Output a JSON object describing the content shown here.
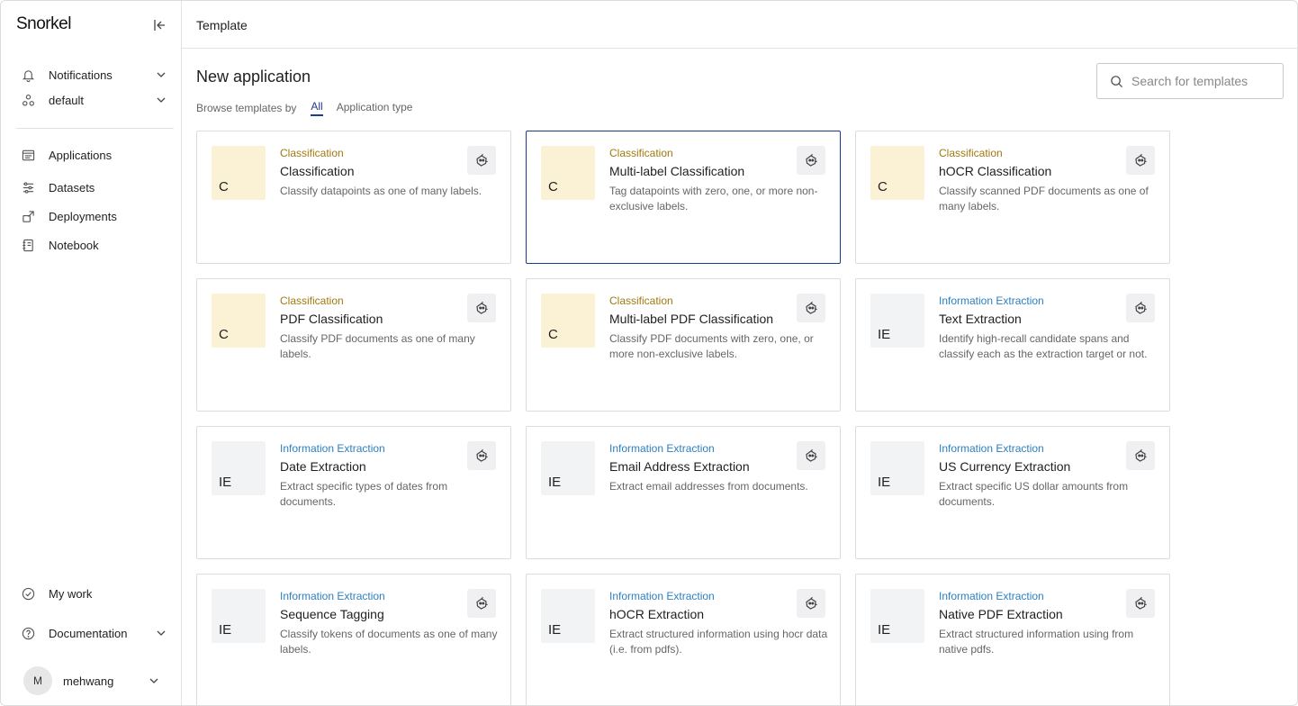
{
  "app": {
    "logo": "Snorkel"
  },
  "sidebar": {
    "notifications": "Notifications",
    "workspace": "default",
    "nav": [
      {
        "label": "Applications",
        "icon": "applications-icon"
      },
      {
        "label": "Datasets",
        "icon": "datasets-icon"
      },
      {
        "label": "Deployments",
        "icon": "deployments-icon"
      },
      {
        "label": "Notebook",
        "icon": "notebook-icon"
      }
    ],
    "my_work": "My work",
    "documentation": "Documentation",
    "user": {
      "initial": "M",
      "name": "mehwang"
    }
  },
  "topbar": {
    "title": "Template"
  },
  "main": {
    "title": "New application",
    "browse_label": "Browse templates by",
    "tabs": [
      "All",
      "Application type"
    ],
    "active_tab": "All",
    "search_placeholder": "Search for templates"
  },
  "colors": {
    "accent": "#1e3a8a",
    "classification": "#a07a10",
    "extraction": "#2d7fc0",
    "classification_bg": "#fbf2d5",
    "extraction_bg": "#f2f3f5"
  },
  "templates": [
    {
      "badge": "C",
      "category": "Classification",
      "name": "Classification",
      "description": "Classify datapoints as one of many labels.",
      "selected": false
    },
    {
      "badge": "C",
      "category": "Classification",
      "name": "Multi-label Classification",
      "description": "Tag datapoints with zero, one, or more non-exclusive labels.",
      "selected": true
    },
    {
      "badge": "C",
      "category": "Classification",
      "name": "hOCR Classification",
      "description": "Classify scanned PDF documents as one of many labels.",
      "selected": false
    },
    {
      "badge": "C",
      "category": "Classification",
      "name": "PDF Classification",
      "description": "Classify PDF documents as one of many labels.",
      "selected": false
    },
    {
      "badge": "C",
      "category": "Classification",
      "name": "Multi-label PDF Classification",
      "description": "Classify PDF documents with zero, one, or more non-exclusive labels.",
      "selected": false
    },
    {
      "badge": "IE",
      "category": "Information Extraction",
      "name": "Text Extraction",
      "description": "Identify high-recall candidate spans and classify each as the extraction target or not.",
      "selected": false
    },
    {
      "badge": "IE",
      "category": "Information Extraction",
      "name": "Date Extraction",
      "description": "Extract specific types of dates from documents.",
      "selected": false
    },
    {
      "badge": "IE",
      "category": "Information Extraction",
      "name": "Email Address Extraction",
      "description": "Extract email addresses from documents.",
      "selected": false
    },
    {
      "badge": "IE",
      "category": "Information Extraction",
      "name": "US Currency Extraction",
      "description": "Extract specific US dollar amounts from documents.",
      "selected": false
    },
    {
      "badge": "IE",
      "category": "Information Extraction",
      "name": "Sequence Tagging",
      "description": "Classify tokens of documents as one of many labels.",
      "selected": false
    },
    {
      "badge": "IE",
      "category": "Information Extraction",
      "name": "hOCR Extraction",
      "description": "Extract structured information using hocr data (i.e. from pdfs).",
      "selected": false
    },
    {
      "badge": "IE",
      "category": "Information Extraction",
      "name": "Native PDF Extraction",
      "description": "Extract structured information using from native pdfs.",
      "selected": false
    }
  ]
}
